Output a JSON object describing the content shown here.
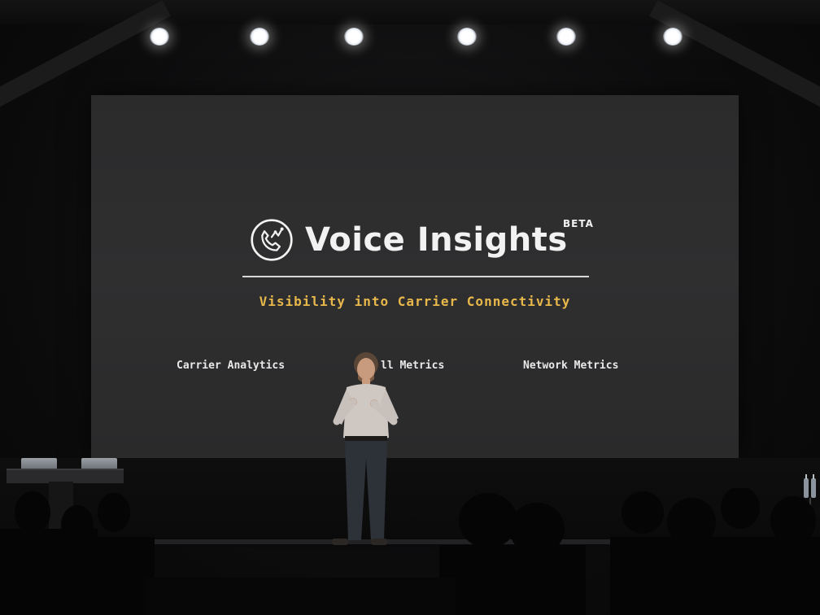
{
  "slide": {
    "product_name": "Voice Insights",
    "beta_label": "BETA",
    "tagline": "Visibility into Carrier Connectivity",
    "features": [
      {
        "label": "Carrier Analytics"
      },
      {
        "label": "ll Metrics"
      },
      {
        "label": "Network Metrics"
      }
    ]
  },
  "icons": {
    "logo": "phone-analytics-circle-icon"
  },
  "colors": {
    "screen_background": "#2e2e2f",
    "title_text": "#f2f2f2",
    "tagline_text": "#e8b84a",
    "feature_text": "#e9e9e9",
    "venue_background": "#0b0b0c"
  }
}
